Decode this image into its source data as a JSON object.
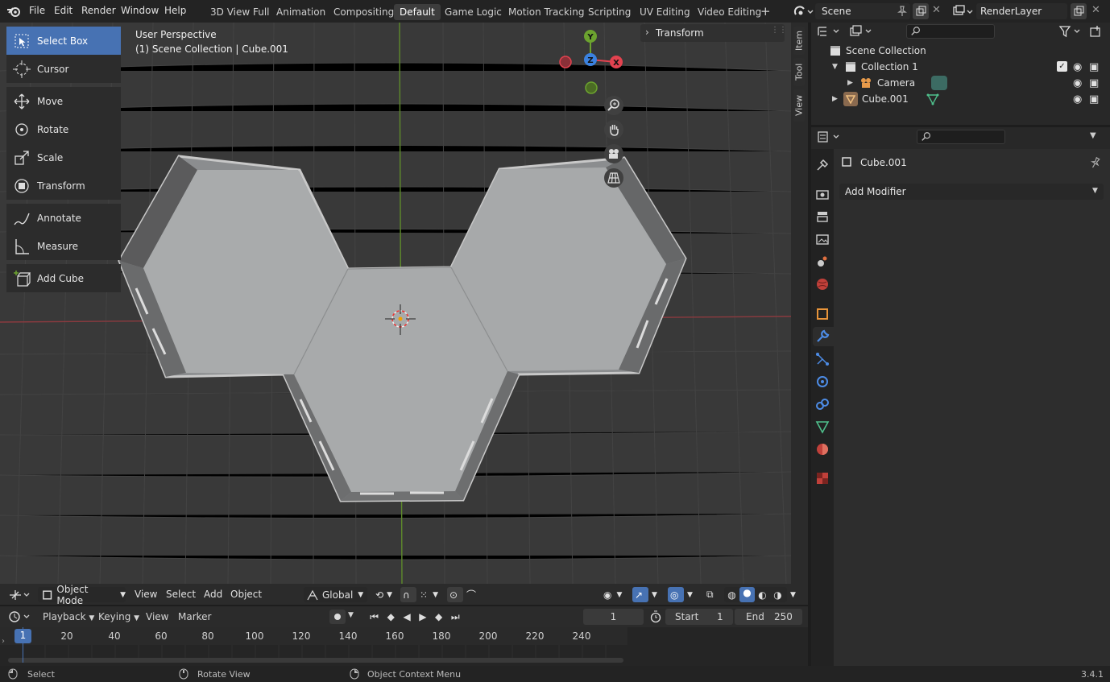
{
  "menu": [
    "File",
    "Edit",
    "Render",
    "Window",
    "Help"
  ],
  "workspaces": [
    "3D View Full",
    "Animation",
    "Compositing",
    "Default",
    "Game Logic",
    "Motion Tracking",
    "Scripting",
    "UV Editing",
    "Video Editing"
  ],
  "active_workspace": "Default",
  "add_workspace": "+",
  "scene": {
    "label": "Scene"
  },
  "view_layer": {
    "label": "RenderLayer"
  },
  "viewport": {
    "perspective": "User Perspective",
    "collection_info": "(1) Scene Collection | Cube.001",
    "transform_panel": "Transform",
    "gizmo": {
      "x": "X",
      "y": "Y",
      "z": "Z"
    }
  },
  "side_tabs": [
    "Item",
    "Tool",
    "View"
  ],
  "tools": [
    {
      "label": "Select Box",
      "icon": "select-box-icon",
      "active": true
    },
    {
      "label": "Cursor",
      "icon": "cursor-icon"
    },
    {
      "label": "Move",
      "icon": "move-icon"
    },
    {
      "label": "Rotate",
      "icon": "rotate-icon"
    },
    {
      "label": "Scale",
      "icon": "scale-icon"
    },
    {
      "label": "Transform",
      "icon": "transform-icon"
    },
    {
      "label": "Annotate",
      "icon": "annotate-icon"
    },
    {
      "label": "Measure",
      "icon": "measure-icon"
    },
    {
      "label": "Add Cube",
      "icon": "add-cube-icon"
    }
  ],
  "header": {
    "mode": "Object Mode",
    "menus": [
      "View",
      "Select",
      "Add",
      "Object"
    ],
    "orientation": "Global"
  },
  "timeline": {
    "menus": [
      "Playback",
      "Keying",
      "View",
      "Marker"
    ],
    "current_frame": "1",
    "start_label": "Start",
    "start": "1",
    "end_label": "End",
    "end": "250",
    "ticks": [
      "20",
      "40",
      "60",
      "80",
      "100",
      "120",
      "140",
      "160",
      "180",
      "200",
      "220",
      "240"
    ],
    "cursor": "1"
  },
  "status": {
    "select": "Select",
    "rotate": "Rotate View",
    "context": "Object Context Menu",
    "version": "3.4.1"
  },
  "outliner": {
    "rows": [
      {
        "label": "Scene Collection"
      },
      {
        "label": "Collection 1"
      },
      {
        "label": "Camera"
      },
      {
        "label": "Cube.001"
      }
    ]
  },
  "properties": {
    "object_name": "Cube.001",
    "add_modifier": "Add Modifier"
  },
  "colors": {
    "accent": "#4772b3",
    "x_axis": "#e3424f",
    "y_axis": "#6ca32f",
    "z_axis": "#3b82e0",
    "mesh": "#a9abac"
  }
}
